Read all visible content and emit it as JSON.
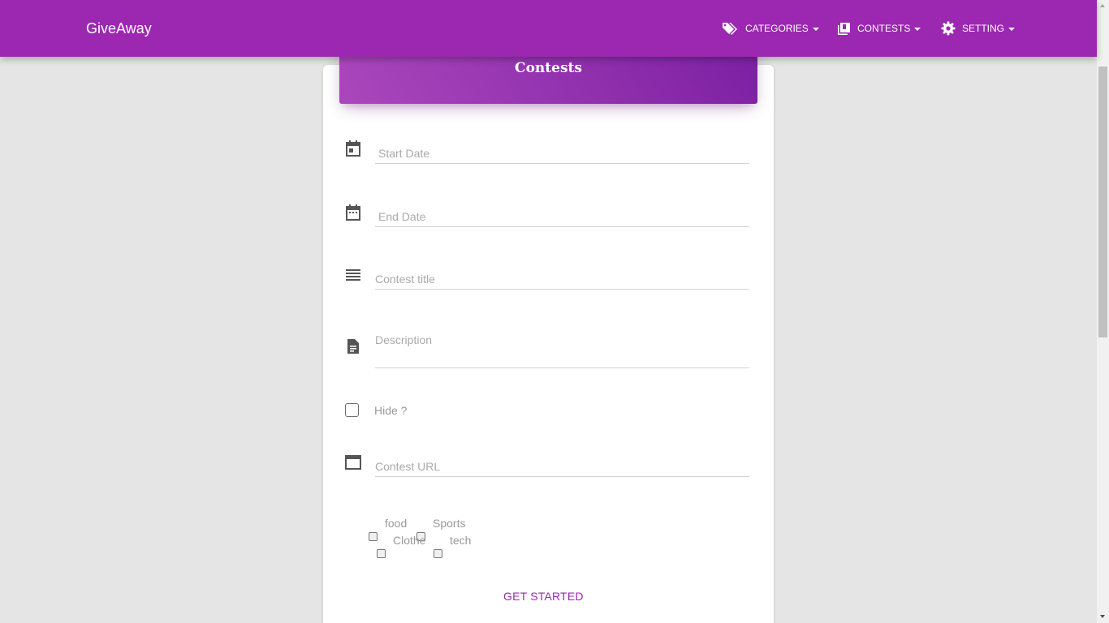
{
  "brand": "GiveAway",
  "nav": {
    "categories": {
      "label": "CATEGORIES",
      "icon": "tag-icon"
    },
    "contests": {
      "label": "CONTESTS",
      "icon": "library-icon"
    },
    "setting": {
      "label": "SETTING",
      "icon": "gear-icon"
    }
  },
  "card": {
    "title": "Contests"
  },
  "form": {
    "start_date": {
      "placeholder": "Start Date",
      "icon": "calendar-today-icon"
    },
    "end_date": {
      "placeholder": "End Date",
      "icon": "calendar-icon"
    },
    "title": {
      "placeholder": "Contest title",
      "icon": "lines-icon"
    },
    "description": {
      "placeholder": "Description",
      "icon": "document-icon"
    },
    "hide": {
      "label": "Hide ?",
      "checked": false
    },
    "url": {
      "placeholder": "Contest URL",
      "icon": "window-icon"
    },
    "categories": [
      {
        "label": "food",
        "checked": false
      },
      {
        "label": "Sports",
        "checked": false
      },
      {
        "label": "Clothe",
        "checked": false
      },
      {
        "label": "tech",
        "checked": false
      }
    ],
    "submit_label": "GET STARTED"
  },
  "colors": {
    "primary": "#9c27b0",
    "background": "#e5e5e5"
  }
}
